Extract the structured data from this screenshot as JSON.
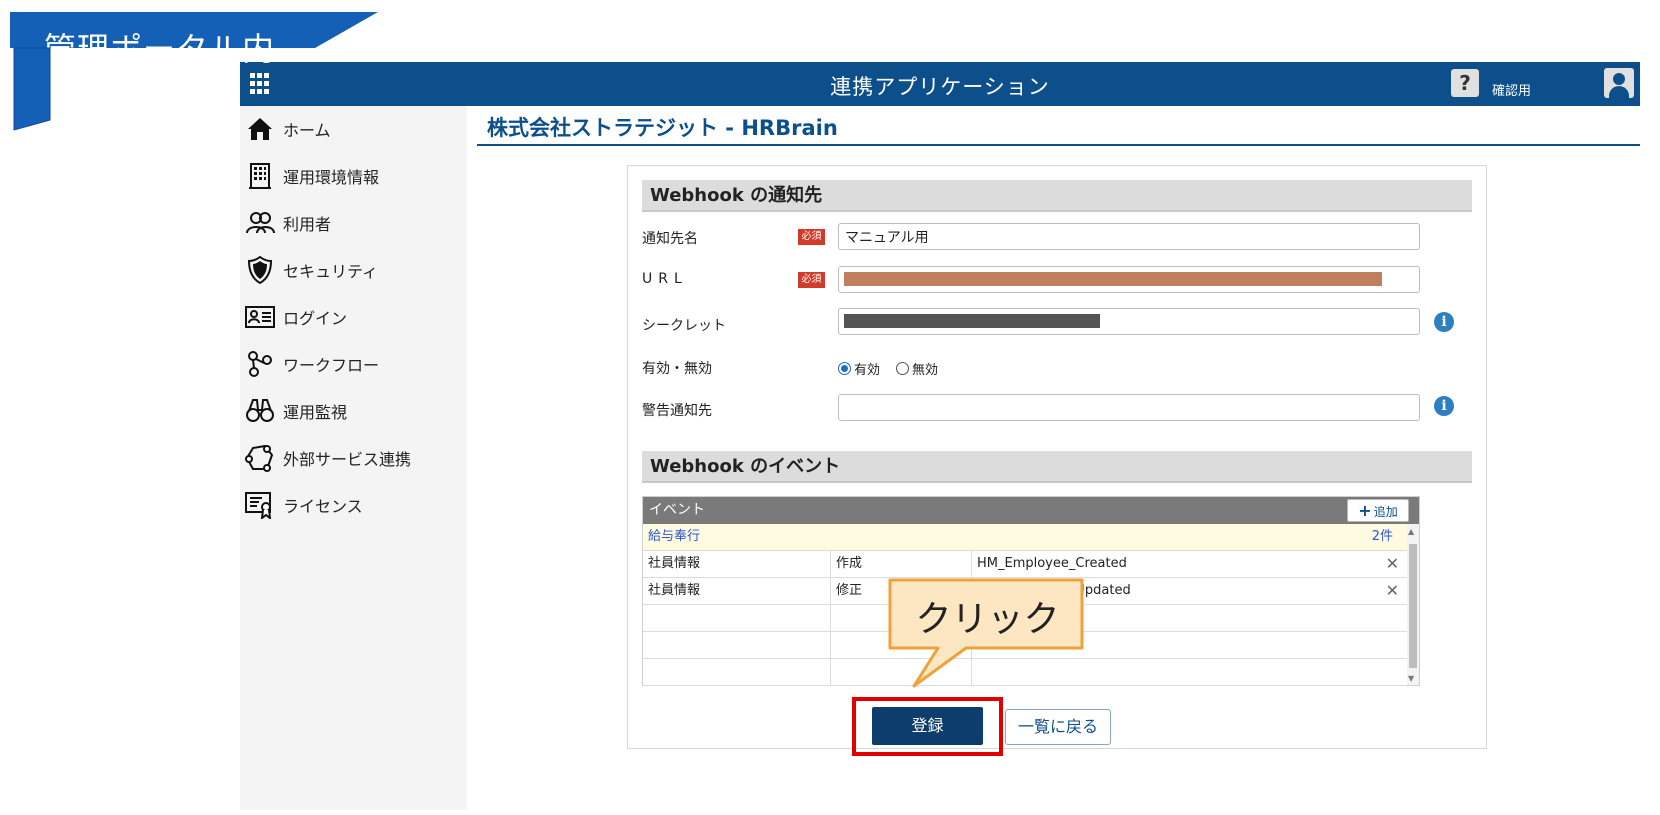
{
  "banner": {
    "text": "管理ポータル内",
    "color": "#1560b7"
  },
  "header": {
    "title": "連携アプリケーション",
    "help_label": "?",
    "user_label": "確認用",
    "color": "#0d4f8b"
  },
  "sidebar": {
    "items": [
      {
        "label": "ホーム",
        "icon": "home-icon"
      },
      {
        "label": "運用環境情報",
        "icon": "building-icon"
      },
      {
        "label": "利用者",
        "icon": "users-icon"
      },
      {
        "label": "セキュリティ",
        "icon": "shield-icon"
      },
      {
        "label": "ログイン",
        "icon": "id-card-icon"
      },
      {
        "label": "ワークフロー",
        "icon": "workflow-icon"
      },
      {
        "label": "運用監視",
        "icon": "binoculars-icon"
      },
      {
        "label": "外部サービス連携",
        "icon": "external-service-icon"
      },
      {
        "label": "ライセンス",
        "icon": "license-icon"
      }
    ]
  },
  "page": {
    "title": "株式会社ストラテジット - HRBrain"
  },
  "form": {
    "section1_title": "Webhook の通知先",
    "required_label": "必須",
    "name_label": "通知先名",
    "name_value": "マニュアル用",
    "url_label": "URL",
    "secret_label": "シークレット",
    "enabled_label": "有効・無効",
    "enabled_on": "有効",
    "enabled_off": "無効",
    "warning_label": "警告通知先",
    "warning_value": ""
  },
  "events": {
    "section_title": "Webhook のイベント",
    "header": "イベント",
    "add_label": "追加",
    "group": {
      "name": "給与奉行",
      "count": "2件"
    },
    "rows": [
      {
        "category": "社員情報",
        "action": "作成",
        "event": "HM_Employee_Created"
      },
      {
        "category": "社員情報",
        "action": "修正",
        "event": "HM_Employee_Updated"
      }
    ]
  },
  "buttons": {
    "register": "登録",
    "back": "一覧に戻る"
  },
  "callout": {
    "text": "クリック"
  },
  "colors": {
    "accent": "#0d4f8b",
    "required": "#d23a2a",
    "highlight": "#e00000",
    "callout_fill": "#fde7c2",
    "callout_border": "#f0a23a"
  }
}
